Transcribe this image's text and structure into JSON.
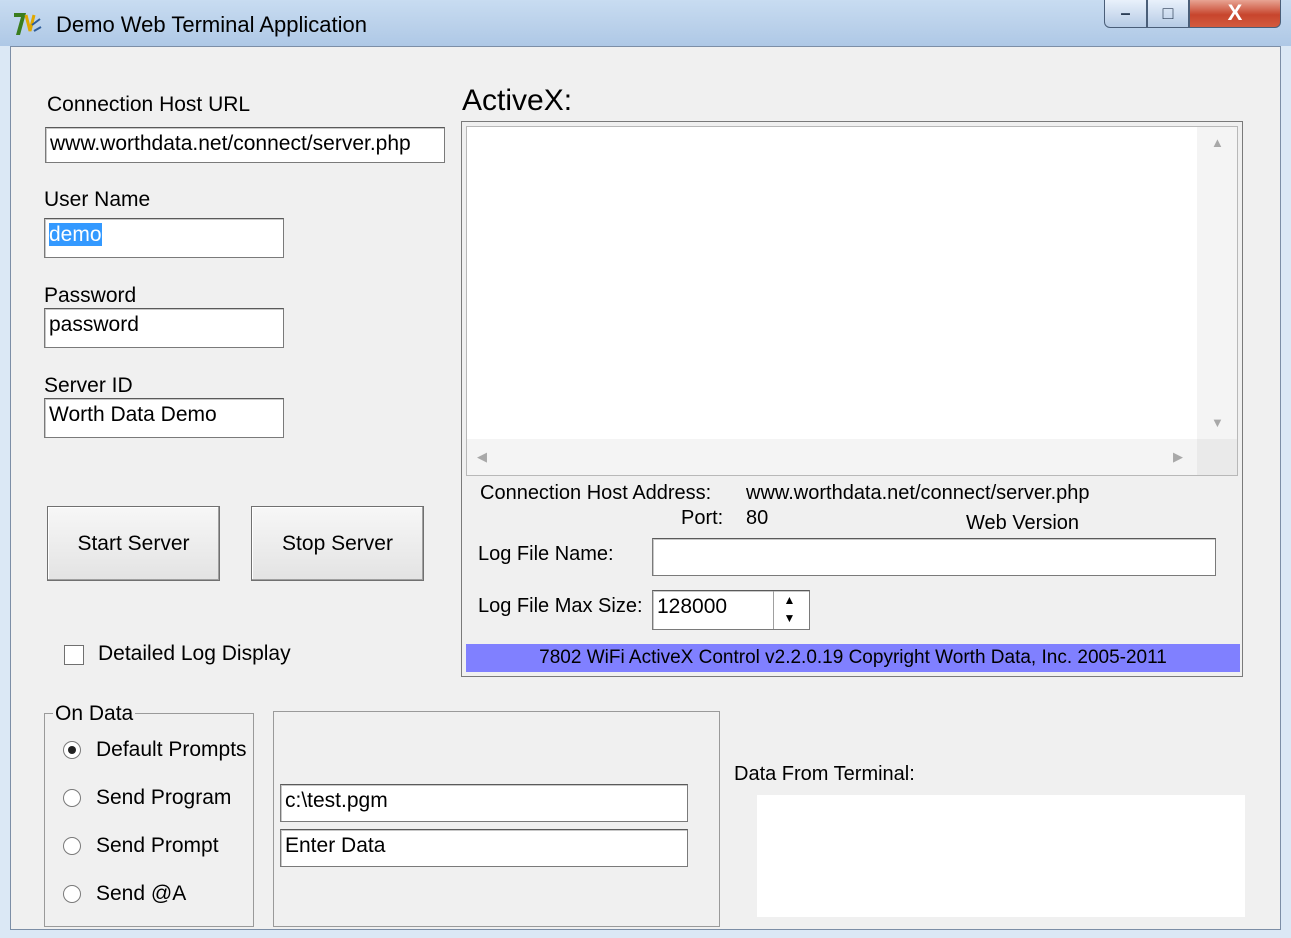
{
  "window": {
    "title": "Demo Web Terminal Application",
    "controls": {
      "minimize": "–",
      "maximize": "□",
      "close": "X"
    }
  },
  "form": {
    "host_url_label": "Connection Host URL",
    "host_url_value": "www.worthdata.net/connect/server.php",
    "username_label": "User Name",
    "username_value": "demo",
    "password_label": "Password",
    "password_value": "password",
    "server_id_label": "Server ID",
    "server_id_value": "Worth Data Demo",
    "start_button": "Start Server",
    "stop_button": "Stop Server",
    "detailed_log_label": "Detailed Log Display",
    "detailed_log_checked": false
  },
  "on_data": {
    "title": "On Data",
    "options": [
      {
        "label": "Default Prompts",
        "selected": true
      },
      {
        "label": "Send Program",
        "selected": false
      },
      {
        "label": "Send Prompt",
        "selected": false
      },
      {
        "label": "Send @A",
        "selected": false
      }
    ],
    "program_value": "c:\\test.pgm",
    "prompt_value": "Enter Data"
  },
  "activex": {
    "heading": "ActiveX:",
    "host_address_label": "Connection Host Address:",
    "host_address_value": "www.worthdata.net/connect/server.php",
    "port_label": "Port:",
    "port_value": "80",
    "version_text": "Web Version",
    "log_file_name_label": "Log File Name:",
    "log_file_name_value": "",
    "log_max_size_label": "Log File Max Size:",
    "log_max_size_value": "128000",
    "footer": "7802 WiFi ActiveX Control v2.2.0.19 Copyright Worth Data, Inc. 2005-2011",
    "footer_color": "#8080ff"
  },
  "terminal": {
    "label": "Data From Terminal:",
    "value": ""
  }
}
